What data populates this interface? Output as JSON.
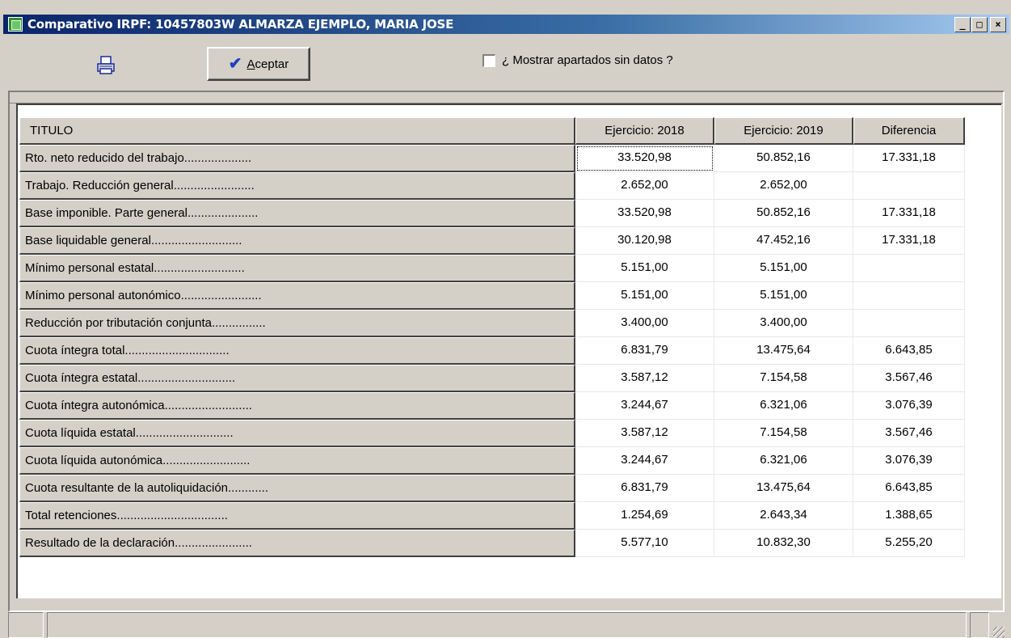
{
  "window": {
    "title": "Comparativo IRPF: 10457803W ALMARZA EJEMPLO, MARIA JOSE",
    "minimize_glyph": "_",
    "maximize_glyph": "□",
    "close_glyph": "×"
  },
  "toolbar": {
    "print_icon": "printer-icon",
    "accept_label": "Aceptar",
    "accept_icon": "checkmark-icon",
    "show_empty_label": "¿ Mostrar apartados sin datos ?",
    "show_empty_checked": false
  },
  "table": {
    "columns": [
      "TITULO",
      "Ejercicio: 2018",
      "Ejercicio: 2019",
      "Diferencia"
    ],
    "rows": [
      [
        "Rto. neto reducido del trabajo....................",
        "33.520,98",
        "50.852,16",
        "17.331,18"
      ],
      [
        "Trabajo. Reducción general........................",
        "2.652,00",
        "2.652,00",
        ""
      ],
      [
        "Base imponible. Parte general.....................",
        "33.520,98",
        "50.852,16",
        "17.331,18"
      ],
      [
        "Base liquidable general...........................",
        "30.120,98",
        "47.452,16",
        "17.331,18"
      ],
      [
        "Mínimo personal estatal...........................",
        "5.151,00",
        "5.151,00",
        ""
      ],
      [
        "Mínimo personal autonómico........................",
        "5.151,00",
        "5.151,00",
        ""
      ],
      [
        "Reducción por tributación conjunta................",
        "3.400,00",
        "3.400,00",
        ""
      ],
      [
        "Cuota íntegra total...............................",
        "6.831,79",
        "13.475,64",
        "6.643,85"
      ],
      [
        "Cuota íntegra estatal.............................",
        "3.587,12",
        "7.154,58",
        "3.567,46"
      ],
      [
        "Cuota íntegra autonómica..........................",
        "3.244,67",
        "6.321,06",
        "3.076,39"
      ],
      [
        "Cuota líquida estatal.............................",
        "3.587,12",
        "7.154,58",
        "3.567,46"
      ],
      [
        "Cuota líquida autonómica..........................",
        "3.244,67",
        "6.321,06",
        "3.076,39"
      ],
      [
        "Cuota resultante de la autoliquidación............",
        "6.831,79",
        "13.475,64",
        "6.643,85"
      ],
      [
        "Total retenciones.................................",
        "1.254,69",
        "2.643,34",
        "1.388,65"
      ],
      [
        "Resultado de la declaración.......................",
        "5.577,10",
        "10.832,30",
        "5.255,20"
      ]
    ]
  }
}
